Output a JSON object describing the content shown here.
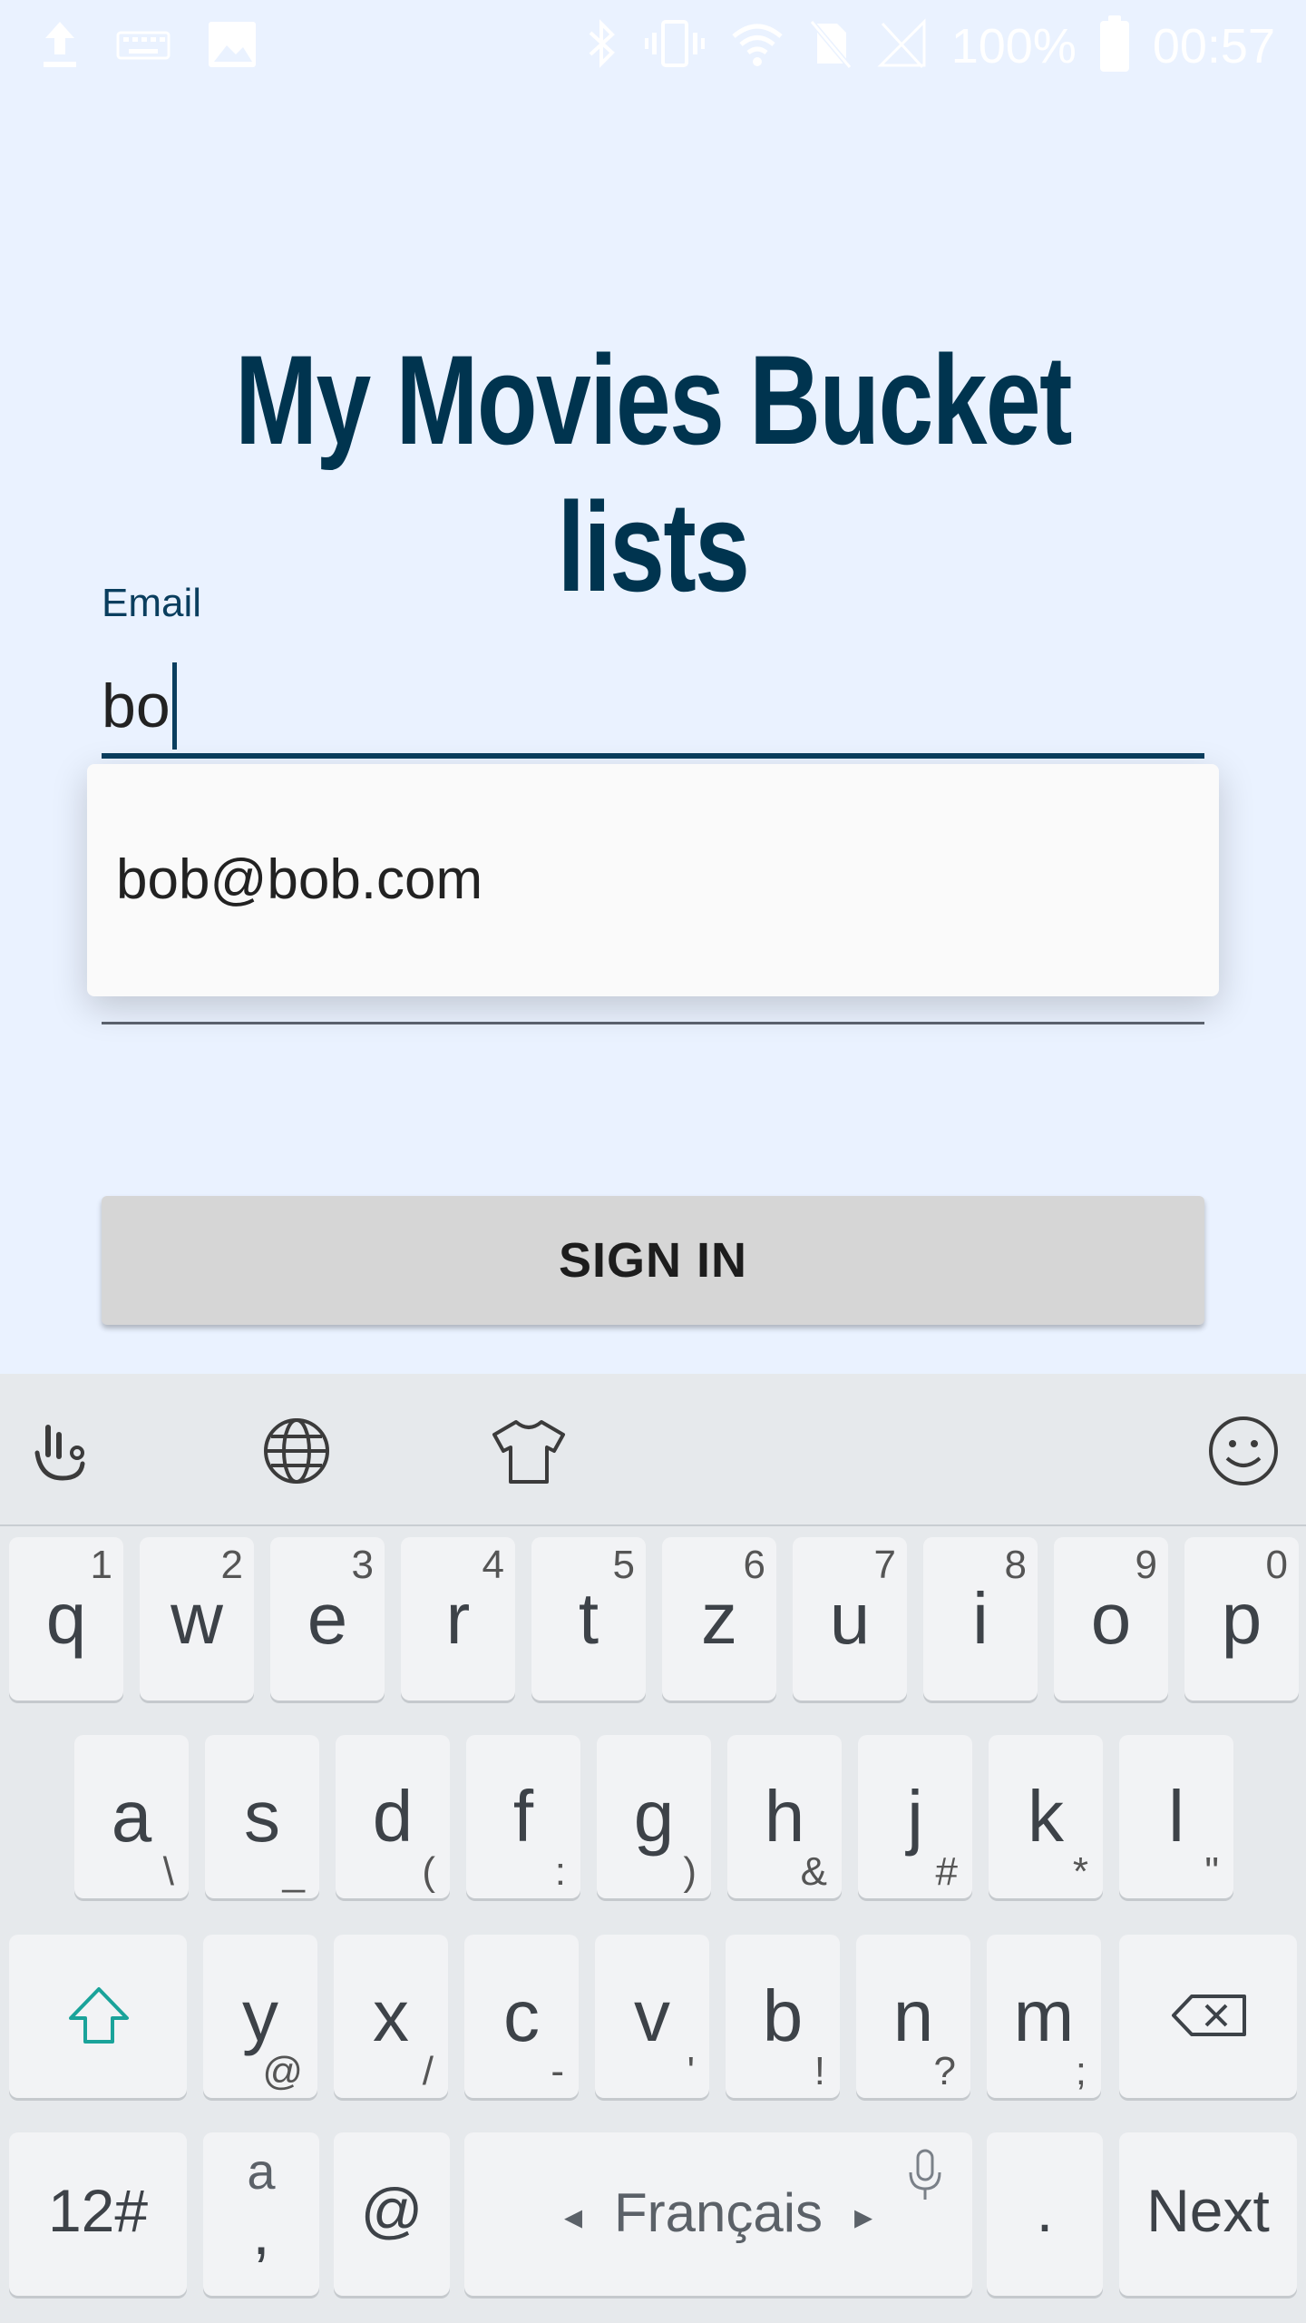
{
  "status_bar": {
    "battery_percent": "100%",
    "time": "00:57",
    "left_icons": [
      "upload-icon",
      "keyboard-icon",
      "image-icon"
    ],
    "right_icons": [
      "bluetooth-icon",
      "vibrate-icon",
      "wifi-icon",
      "no-sim-icon",
      "signal-icon",
      "battery-icon"
    ]
  },
  "app": {
    "title": "My Movies Bucket lists"
  },
  "form": {
    "email_label": "Email",
    "email_value": "bo",
    "autocomplete_suggestion": "bob@bob.com",
    "sign_in_label": "SIGN IN"
  },
  "keyboard": {
    "toolbar_icons": [
      "gesture-icon",
      "globe-icon",
      "theme-shirt-icon",
      "emoji-icon"
    ],
    "row1": [
      {
        "key": "q",
        "sub": "1"
      },
      {
        "key": "w",
        "sub": "2"
      },
      {
        "key": "e",
        "sub": "3"
      },
      {
        "key": "r",
        "sub": "4"
      },
      {
        "key": "t",
        "sub": "5"
      },
      {
        "key": "z",
        "sub": "6"
      },
      {
        "key": "u",
        "sub": "7"
      },
      {
        "key": "i",
        "sub": "8"
      },
      {
        "key": "o",
        "sub": "9"
      },
      {
        "key": "p",
        "sub": "0"
      }
    ],
    "row2": [
      {
        "key": "a",
        "sub": "\\"
      },
      {
        "key": "s",
        "sub": "_"
      },
      {
        "key": "d",
        "sub": "("
      },
      {
        "key": "f",
        "sub": ":"
      },
      {
        "key": "g",
        "sub": ")"
      },
      {
        "key": "h",
        "sub": "&"
      },
      {
        "key": "j",
        "sub": "#"
      },
      {
        "key": "k",
        "sub": "*"
      },
      {
        "key": "l",
        "sub": "\""
      }
    ],
    "row3": [
      {
        "key": "y",
        "sub": "@"
      },
      {
        "key": "x",
        "sub": "/"
      },
      {
        "key": "c",
        "sub": "-"
      },
      {
        "key": "v",
        "sub": "'"
      },
      {
        "key": "b",
        "sub": "!"
      },
      {
        "key": "n",
        "sub": "?"
      },
      {
        "key": "m",
        "sub": ";"
      }
    ],
    "symbols_key": "12#",
    "comma_key_top": "a",
    "comma_key": ",",
    "at_key": "@",
    "space_label": "Français",
    "period_key": ".",
    "next_key": "Next",
    "colors": {
      "shift_accent": "#1aa39a",
      "key_bg": "#f2f3f5",
      "kb_bg": "#e6e9ec"
    }
  },
  "colors": {
    "background": "#eaf2ff",
    "title": "#00344f",
    "accent": "#0a3e5e",
    "button": "#d6d6d6"
  }
}
